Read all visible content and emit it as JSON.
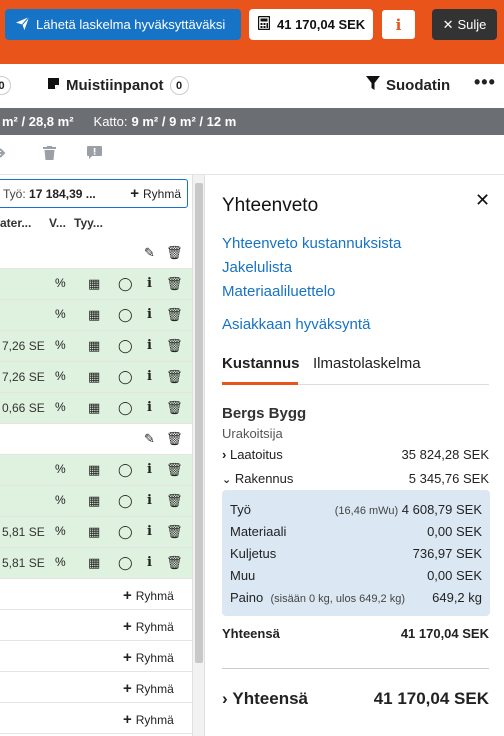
{
  "header": {
    "send_label": "Lähetä laskelma hyväksyttäväksi",
    "total_label": "41 170,04 SEK",
    "info_label": "i",
    "close_label": "Sulje"
  },
  "toolbar": {
    "left_count": "0",
    "notes_label": "Muistiinpanot",
    "notes_count": "0",
    "filter_label": "Suodatin",
    "more_label": "•••"
  },
  "areas": {
    "wall_text": "m² / 28,8 m²",
    "roof_label": "Katto:",
    "roof_text": "9 m² / 9 m² / 12 m"
  },
  "table": {
    "work_prefix": "Työ:",
    "work_value": "17 184,39 ...",
    "group_label": "Ryhmä",
    "columns": [
      "ater...",
      "V...",
      "Tyy..."
    ],
    "row_values": [
      "7,26 SE",
      "7,26 SE",
      "0,66 SE",
      "5,81 SE",
      "5,81 SE"
    ]
  },
  "summary": {
    "title": "Yhteenveto",
    "links": [
      "Yhteenveto kustannuksista",
      "Jakelulista",
      "Materiaaliluettelo",
      "Asiakkaan hyväksyntä"
    ],
    "tabs": [
      "Kustannus",
      "Ilmastolaskelma"
    ],
    "company": "Bergs Bygg",
    "role": "Urakoitsija",
    "lines": [
      {
        "label": "Laatoitus",
        "value": "35 824,28 SEK"
      },
      {
        "label": "Rakennus",
        "value": "5 345,76 SEK"
      }
    ],
    "details": [
      {
        "label": "Työ",
        "note": "(16,46 mWu)",
        "value": "4 608,79 SEK"
      },
      {
        "label": "Materiaali",
        "note": "",
        "value": "0,00 SEK"
      },
      {
        "label": "Kuljetus",
        "note": "",
        "value": "736,97 SEK"
      },
      {
        "label": "Muu",
        "note": "",
        "value": "0,00 SEK"
      },
      {
        "label": "Paino",
        "note": "(sisään 0 kg, ulos 649,2 kg)",
        "value": "649,2 kg"
      }
    ],
    "subtotal_label": "Yhteensä",
    "subtotal_value": "41 170,04 SEK",
    "total_label": "Yhteensä",
    "total_value": "41 170,04 SEK"
  },
  "colors": {
    "brand_orange": "#e8541a",
    "primary_blue": "#1773c6",
    "row_green": "#dff2df",
    "detail_blue": "#dbe8f4"
  }
}
